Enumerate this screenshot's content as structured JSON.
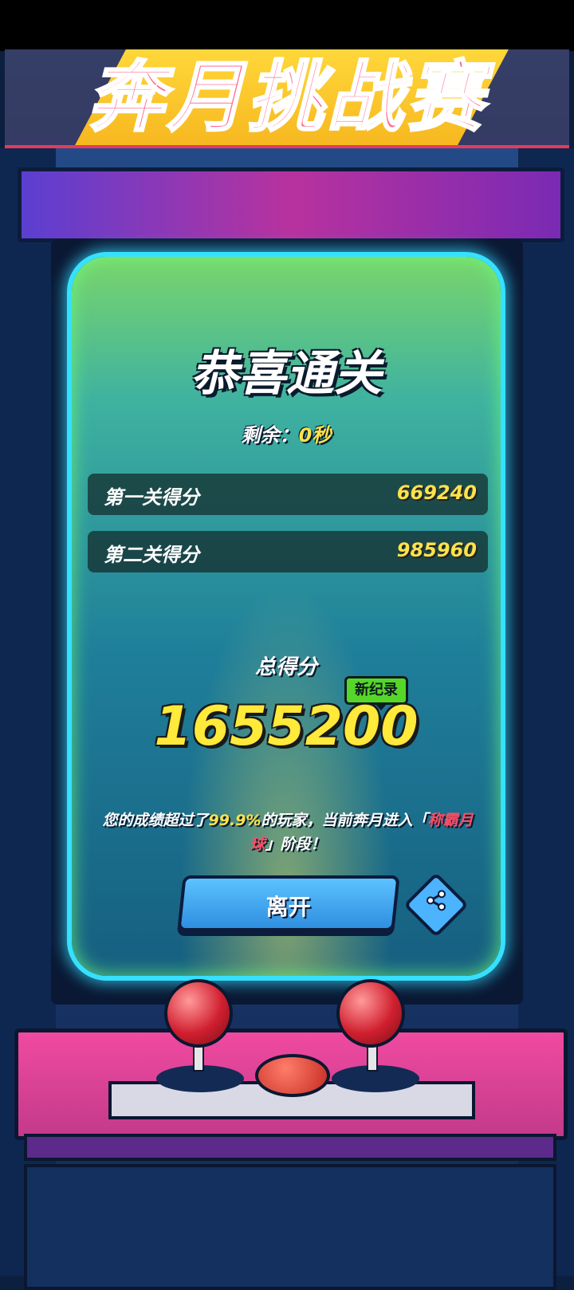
{
  "marquee": {
    "title": "奔月挑战赛"
  },
  "result": {
    "title": "恭喜通关",
    "remaining_label": "剩余：",
    "remaining_value": "0秒",
    "rows": [
      {
        "label": "第一关得分",
        "value": "669240"
      },
      {
        "label": "第二关得分",
        "value": "985960"
      }
    ],
    "total_label": "总得分",
    "new_record_badge": "新纪录",
    "total_value": "1655200",
    "desc_prefix": "您的成绩超过了",
    "desc_percent": "99.9%",
    "desc_middle": "的玩家，当前奔月进入「",
    "desc_stage": "称霸月球",
    "desc_suffix": "」阶段！"
  },
  "actions": {
    "leave_label": "离开",
    "share_icon": "share-icon"
  },
  "colors": {
    "accent_yellow": "#ffe24a",
    "badge_green": "#57d62a",
    "button_blue": "#2f8fe0",
    "stage_red": "#ff4c66"
  }
}
